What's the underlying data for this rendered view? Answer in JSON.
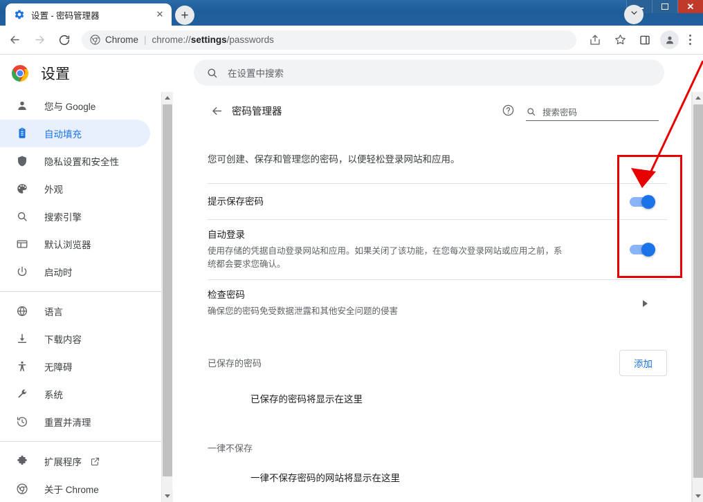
{
  "window": {
    "controls": [
      {
        "name": "minimize",
        "glyph": "minimize-icon"
      },
      {
        "name": "maximize",
        "glyph": "maximize-icon"
      },
      {
        "name": "close",
        "glyph": "close-icon",
        "label": "✕"
      }
    ]
  },
  "tabstrip": {
    "tab": {
      "title": "设置 - 密码管理器",
      "favicon": "gear-icon",
      "close_label": "✕"
    },
    "new_tab_label": "+",
    "tab_search_icon": "chevron-down-icon"
  },
  "toolbar": {
    "back_icon": "←",
    "forward_icon": "→",
    "reload_icon": "reload-icon",
    "omnibox": {
      "brand": "Chrome",
      "separator": "|",
      "url_prefix": "chrome://",
      "url_bold": "settings",
      "url_suffix": "/passwords",
      "full_url": "chrome://settings/passwords"
    },
    "share_icon": "share-icon",
    "bookmark_icon": "star-icon",
    "sidepanel_icon": "side-panel-icon",
    "profile_icon": "avatar-icon",
    "menu_icon": "three-dots-icon"
  },
  "settings_header": {
    "logo": "chrome-logo",
    "title": "设置",
    "search_placeholder": "在设置中搜索",
    "search_icon": "search-icon"
  },
  "sidebar": {
    "items": [
      {
        "label": "您与 Google",
        "icon": "person-icon",
        "active": false
      },
      {
        "label": "自动填充",
        "icon": "clipboard-icon",
        "active": true
      },
      {
        "label": "隐私设置和安全性",
        "icon": "shield-icon",
        "active": false
      },
      {
        "label": "外观",
        "icon": "palette-icon",
        "active": false
      },
      {
        "label": "搜索引擎",
        "icon": "search-icon",
        "active": false
      },
      {
        "label": "默认浏览器",
        "icon": "browser-window-icon",
        "active": false
      },
      {
        "label": "启动时",
        "icon": "power-icon",
        "active": false
      }
    ],
    "items_group2": [
      {
        "label": "语言",
        "icon": "globe-icon",
        "active": false
      },
      {
        "label": "下载内容",
        "icon": "download-icon",
        "active": false
      },
      {
        "label": "无障碍",
        "icon": "accessibility-icon",
        "active": false
      },
      {
        "label": "系统",
        "icon": "wrench-icon",
        "active": false
      },
      {
        "label": "重置并清理",
        "icon": "restore-icon",
        "active": false
      }
    ],
    "items_group3": [
      {
        "label": "扩展程序",
        "icon": "puzzle-icon",
        "external": true,
        "active": false
      },
      {
        "label": "关于 Chrome",
        "icon": "chrome-icon",
        "external": false,
        "active": false
      }
    ]
  },
  "main": {
    "back_icon": "←",
    "page_title": "密码管理器",
    "help_icon": "help-circle-icon",
    "search_icon": "search-icon",
    "search_placeholder": "搜索密码",
    "description": "您可创建、保存和管理您的密码，以便轻松登录网站和应用。",
    "rows": [
      {
        "title": "提示保存密码",
        "subtitle": "",
        "control": "toggle",
        "toggle_on": true
      },
      {
        "title": "自动登录",
        "subtitle": "使用存储的凭据自动登录网站和应用。如果关闭了该功能，在您每次登录网站或应用之前，系统都会要求您确认。",
        "control": "toggle",
        "toggle_on": true
      },
      {
        "title": "检查密码",
        "subtitle": "确保您的密码免受数据泄露和其他安全问题的侵害",
        "control": "chevron",
        "toggle_on": false
      }
    ],
    "saved_section": {
      "label": "已保存的密码",
      "add_button": "添加",
      "empty_text": "已保存的密码将显示在这里"
    },
    "never_section": {
      "label": "一律不保存",
      "empty_text": "一律不保存密码的网站将显示在这里"
    }
  },
  "annotations": {
    "highlight_box_color": "#e60000",
    "arrow_color": "#e60000",
    "arrow_target": "save-password-toggle"
  },
  "colors": {
    "titlebar_blue": "#225f9e",
    "accent_blue": "#1a73e8",
    "toggle_track": "#8ab4f8",
    "active_nav_bg": "#e8f0fe",
    "close_button_red": "#c1392b"
  }
}
